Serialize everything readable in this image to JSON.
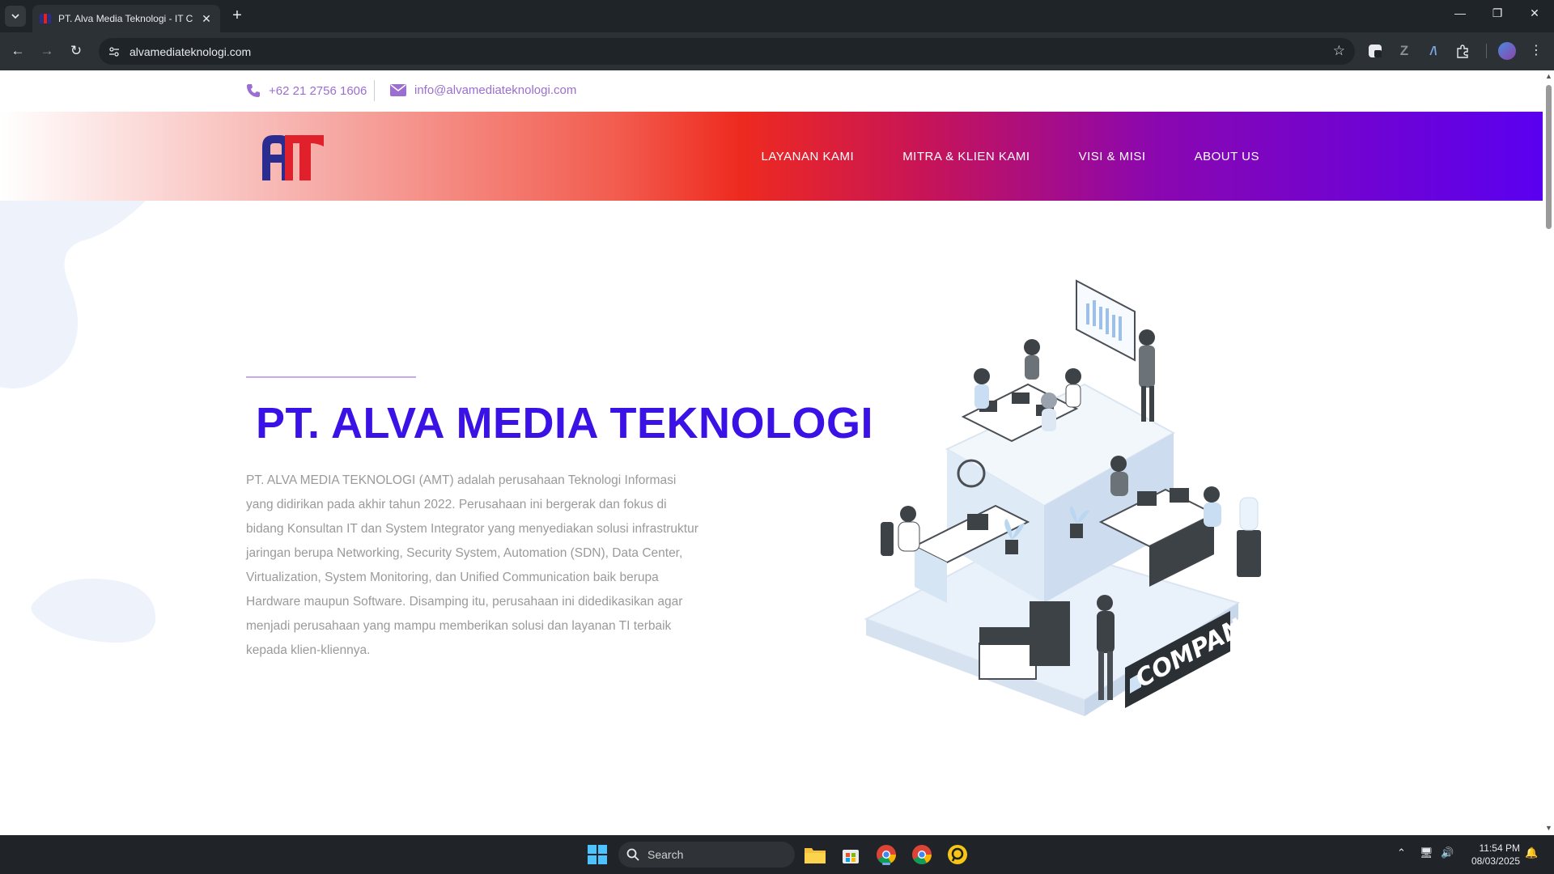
{
  "browser": {
    "tab_title": "PT. Alva Media Teknologi - IT C",
    "url": "alvamediateknologi.com"
  },
  "topbar": {
    "phone": "+62 21 2756 1606",
    "email": "info@alvamediateknologi.com"
  },
  "nav": {
    "items": [
      "LAYANAN KAMI",
      "MITRA & KLIEN KAMI",
      "VISI & MISI",
      "ABOUT US"
    ]
  },
  "hero": {
    "title": "PT. ALVA MEDIA TEKNOLOGI",
    "description": "PT. ALVA MEDIA TEKNOLOGI (AMT) adalah perusahaan Teknologi Informasi yang didirikan pada akhir tahun 2022. Perusahaan ini bergerak dan fokus di bidang Konsultan IT dan System Integrator yang menyediakan solusi infrastruktur jaringan berupa Networking, Security System, Automation (SDN), Data Center, Virtualization, System Monitoring, dan Unified Communication baik berupa Hardware maupun Software. Disamping itu, perusahaan ini didedikasikan agar menjadi perusahaan yang mampu memberikan solusi dan layanan TI terbaik kepada klien-kliennya."
  },
  "illustration": {
    "sign_text": "COMPANY"
  },
  "taskbar": {
    "search_label": "Search",
    "time": "11:54 PM",
    "date": "08/03/2025"
  },
  "colors": {
    "brand_blue": "#3a12e6",
    "accent_purple": "#9b6ed1",
    "header_red": "#ee2a1f",
    "header_violet": "#5a00f0"
  }
}
